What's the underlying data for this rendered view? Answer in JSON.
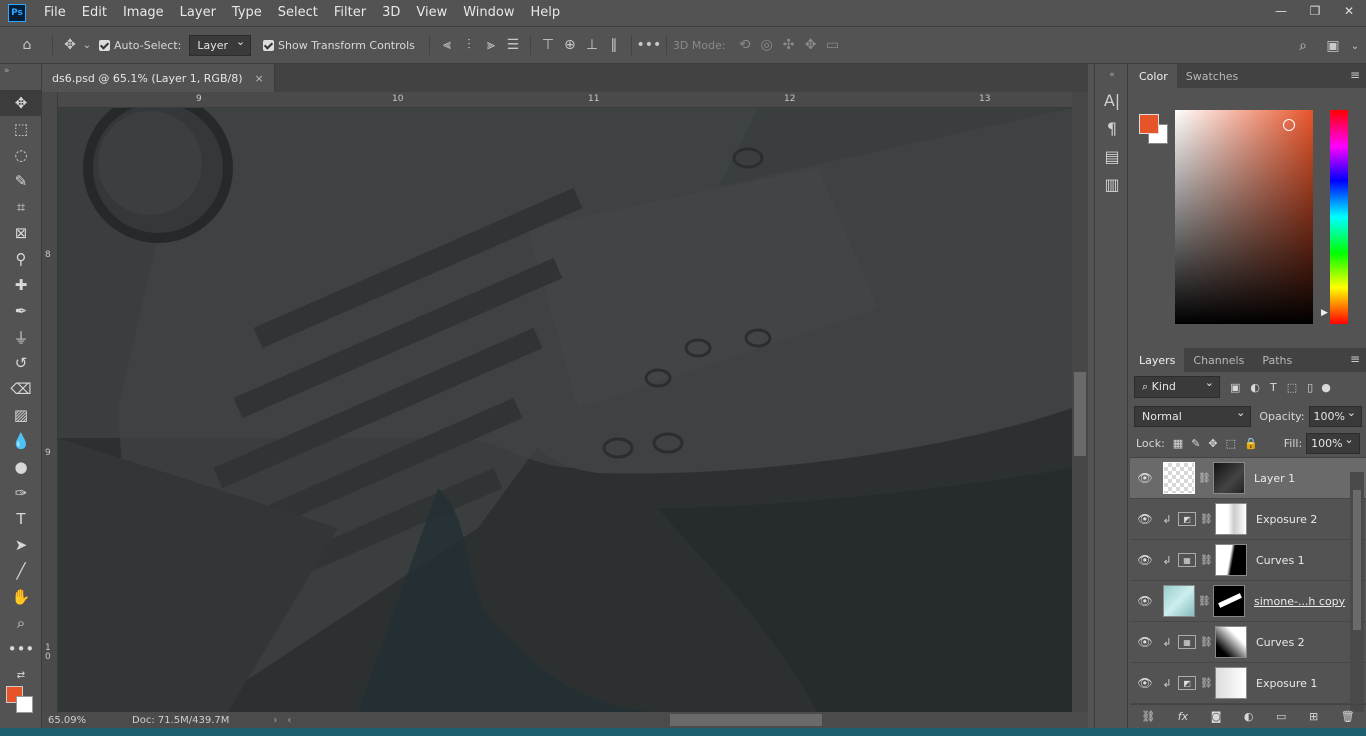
{
  "menubar": {
    "logo": "Ps",
    "items": [
      "File",
      "Edit",
      "Image",
      "Layer",
      "Type",
      "Select",
      "Filter",
      "3D",
      "View",
      "Window",
      "Help"
    ]
  },
  "window_controls": {
    "minimize": "—",
    "restore": "❐",
    "close": "✕"
  },
  "options": {
    "auto_select_label": "Auto-Select:",
    "auto_select_target": "Layer",
    "show_transform_label": "Show Transform Controls",
    "mode_3d_label": "3D Mode:"
  },
  "document": {
    "tab_title": "ds6.psd @ 65.1% (Layer 1, RGB/8)",
    "close_glyph": "×"
  },
  "rulers": {
    "top": [
      "9",
      "10",
      "11",
      "12",
      "13"
    ],
    "left": [
      "8",
      "9",
      "1\n0"
    ]
  },
  "status": {
    "zoom": "65.09%",
    "doc": "Doc: 71.5M/439.7M"
  },
  "color_panel": {
    "tabs": [
      "Color",
      "Swatches"
    ],
    "foreground": "#e8542a",
    "background": "#ffffff"
  },
  "layers_panel": {
    "tabs": [
      "Layers",
      "Channels",
      "Paths"
    ],
    "filter_kind": "Kind",
    "blend_mode": "Normal",
    "opacity_label": "Opacity:",
    "opacity_value": "100%",
    "lock_label": "Lock:",
    "fill_label": "Fill:",
    "fill_value": "100%",
    "layers": [
      {
        "name": "Layer 1",
        "type": "pixel",
        "selected": true
      },
      {
        "name": "Exposure 2",
        "type": "adjustment"
      },
      {
        "name": "Curves 1",
        "type": "adjustment"
      },
      {
        "name": "simone-...h copy",
        "type": "pixel"
      },
      {
        "name": "Curves 2",
        "type": "adjustment"
      },
      {
        "name": "Exposure 1",
        "type": "adjustment"
      }
    ],
    "footer_icons": [
      "link-icon",
      "fx-icon",
      "mask-icon",
      "adjustment-icon",
      "folder-icon",
      "new-layer-icon",
      "trash-icon"
    ]
  }
}
